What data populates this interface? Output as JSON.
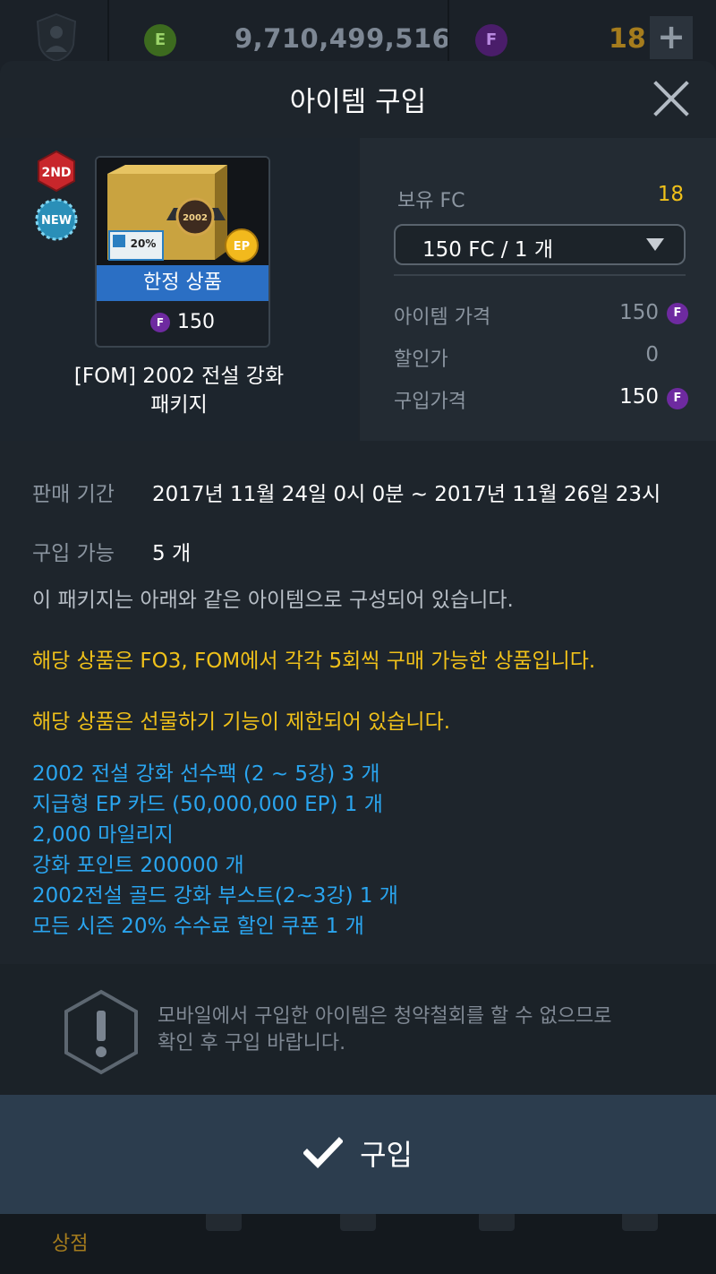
{
  "topbar": {
    "e_coin_label": "E",
    "balance": "9,710,499,516",
    "f_coin_label": "F",
    "fc_count": "18",
    "plus_label": "+"
  },
  "bottom_nav": {
    "shop_label": "상점"
  },
  "modal": {
    "title": "아이템 구입",
    "product": {
      "badge_2nd": "2ND",
      "badge_new": "NEW",
      "limited_label": "한정 상품",
      "card_price": "150",
      "currency_icon": "F",
      "name_line1": "[FOM] 2002 전설 강화",
      "name_line2": "패키지"
    },
    "pricing": {
      "owned_fc_label": "보유 FC",
      "owned_fc_value": "18",
      "select_value": "150 FC / 1 개",
      "item_price_label": "아이템 가격",
      "item_price_value": "150",
      "discount_label": "할인가",
      "discount_value": "0",
      "purchase_price_label": "구입가격",
      "purchase_price_value": "150",
      "currency_icon": "F"
    },
    "info": {
      "sale_period_label": "판매 기간",
      "sale_period_value": "2017년 11월 24일 0시 0분 ~ 2017년 11월 26일 23시",
      "available_label": "구입 가능",
      "available_value": "5 개",
      "description": "이 패키지는 아래와 같은 아이템으로 구성되어 있습니다.",
      "notice1": "해당 상품은 FO3, FOM에서 각각 5회씩 구매 가능한 상품입니다.",
      "notice2": "해당 상품은 선물하기 기능이 제한되어 있습니다.",
      "items": [
        "2002 전설 강화 선수팩 (2 ~ 5강) 3 개",
        "지급형 EP 카드 (50,000,000 EP) 1 개",
        "2,000 마일리지",
        "강화 포인트 200000 개",
        "2002전설 골드 강화 부스트(2~3강) 1 개",
        "모든 시즌 20% 수수료 할인 쿠폰 1 개"
      ]
    },
    "warning": {
      "line1": "모바일에서 구입한 아이템은 청약철회를 할 수 없으므로",
      "line2": "확인 후 구입 바랍니다."
    },
    "buy_button_label": "구입"
  },
  "colors": {
    "accent_gold": "#f0c11a",
    "item_blue": "#2aa5ef",
    "limited_blue": "#2b6fc4",
    "f_coin_purple": "#6e2aa0",
    "buy_button_bg": "#2c3d4e"
  }
}
